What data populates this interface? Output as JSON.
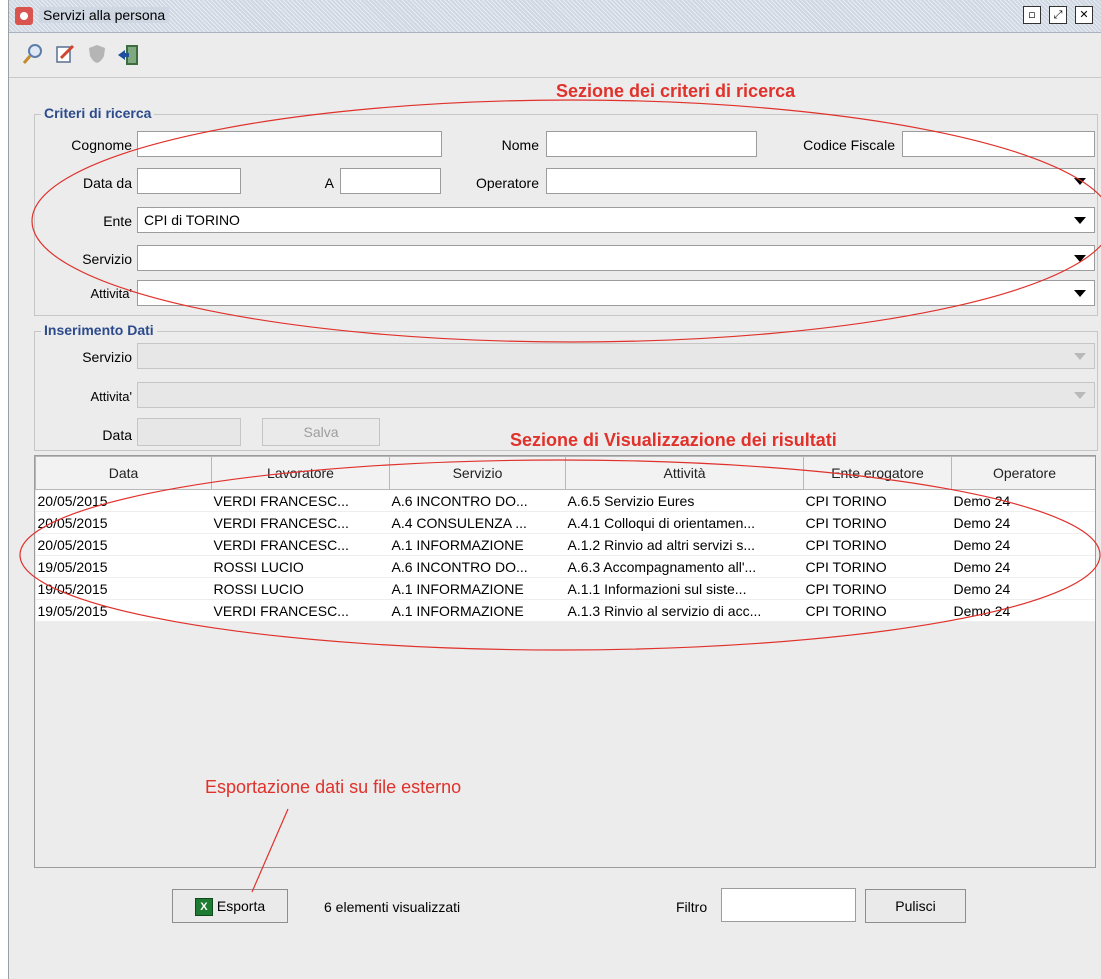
{
  "window": {
    "title": "Servizi alla persona"
  },
  "toolbar": {
    "icons": [
      "search-icon",
      "edit-icon",
      "shield-icon",
      "exit-icon"
    ]
  },
  "search": {
    "title": "Criteri di ricerca",
    "cognome_label": "Cognome",
    "cognome_value": "",
    "nome_label": "Nome",
    "nome_value": "",
    "cf_label": "Codice Fiscale",
    "cf_value": "",
    "data_da_label": "Data da",
    "data_da_value": "",
    "a_label": "A",
    "a_value": "",
    "operatore_label": "Operatore",
    "operatore_value": "",
    "ente_label": "Ente",
    "ente_value": "CPI di TORINO",
    "servizio_label": "Servizio",
    "servizio_value": "",
    "attivita_label": "Attivita'",
    "attivita_value": ""
  },
  "insert": {
    "title": "Inserimento Dati",
    "servizio_label": "Servizio",
    "servizio_value": "",
    "attivita_label": "Attivita'",
    "attivita_value": "",
    "data_label": "Data",
    "data_value": "",
    "save_label": "Salva"
  },
  "annotations": {
    "search_section": "Sezione dei criteri di ricerca",
    "results_section": "Sezione di Visualizzazione dei risultati",
    "export_note": "Esportazione dati su file esterno"
  },
  "table": {
    "columns": [
      "Data",
      "Lavoratore",
      "Servizio",
      "Attività",
      "Ente erogatore",
      "Operatore"
    ],
    "rows": [
      [
        "20/05/2015",
        "VERDI FRANCESC...",
        "A.6 INCONTRO DO...",
        "A.6.5 Servizio Eures",
        "CPI TORINO",
        "Demo 24"
      ],
      [
        "20/05/2015",
        "VERDI FRANCESC...",
        "A.4 CONSULENZA ...",
        "A.4.1 Colloqui di orientamen...",
        "CPI TORINO",
        "Demo 24"
      ],
      [
        "20/05/2015",
        "VERDI FRANCESC...",
        "A.1 INFORMAZIONE",
        "A.1.2 Rinvio ad altri servizi s...",
        "CPI TORINO",
        "Demo 24"
      ],
      [
        "19/05/2015",
        "ROSSI LUCIO",
        "A.6 INCONTRO DO...",
        "A.6.3 Accompagnamento all'...",
        "CPI TORINO",
        "Demo 24"
      ],
      [
        "19/05/2015",
        "ROSSI LUCIO",
        "A.1 INFORMAZIONE",
        "A.1.1 Informazioni sul siste...",
        "CPI TORINO",
        "Demo 24"
      ],
      [
        "19/05/2015",
        "VERDI FRANCESC...",
        "A.1 INFORMAZIONE",
        "A.1.3 Rinvio al servizio di acc...",
        "CPI TORINO",
        "Demo 24"
      ]
    ]
  },
  "footer": {
    "export_label": "Esporta",
    "count_text": "6 elementi visualizzati",
    "filter_label": "Filtro",
    "filter_value": "",
    "clear_label": "Pulisci"
  },
  "colors": {
    "accent": "#2c4a8c",
    "annotation": "#e0312b"
  }
}
